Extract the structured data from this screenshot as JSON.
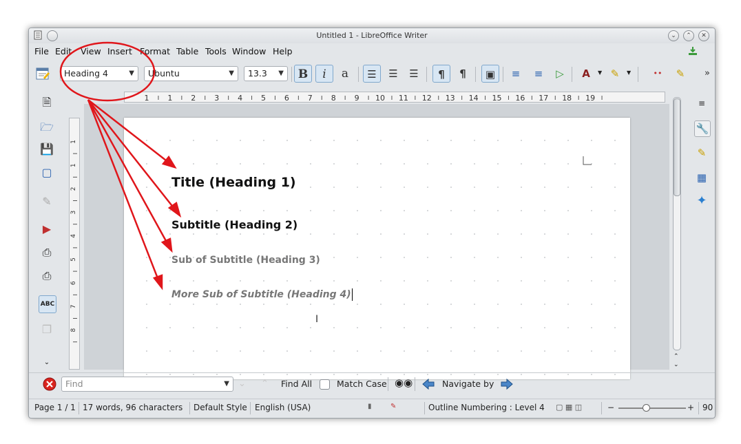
{
  "window": {
    "title": "Untitled 1 - LibreOffice Writer"
  },
  "menu": [
    "File",
    "Edit",
    "View",
    "Insert",
    "Format",
    "Table",
    "Tools",
    "Window",
    "Help"
  ],
  "toolbar": {
    "paragraph_style": "Heading 4",
    "font_name": "Ubuntu",
    "font_size": "13.3"
  },
  "ruler_numbers": [
    "1",
    "1",
    "2",
    "3",
    "4",
    "5",
    "6",
    "7",
    "8",
    "9",
    "10",
    "11",
    "12",
    "13",
    "14",
    "15",
    "16",
    "17",
    "18",
    "19"
  ],
  "vruler_numbers": [
    "1",
    "1",
    "2",
    "3",
    "4",
    "5",
    "6",
    "7",
    "8"
  ],
  "document": {
    "heading1": "Title (Heading 1)",
    "heading2": "Subtitle (Heading 2)",
    "heading3": "Sub of Subtitle (Heading 3)",
    "heading4": "More Sub of Subtitle (Heading 4)"
  },
  "findbar": {
    "placeholder": "Find",
    "find_all": "Find All",
    "match_case": "Match Case",
    "navigate_by": "Navigate by"
  },
  "status": {
    "page": "Page 1 / 1",
    "words": "17 words, 96 characters",
    "page_style": "Default Style",
    "language": "English (USA)",
    "outline": "Outline Numbering : Level 4",
    "zoom": "90"
  },
  "icons": {
    "spellcheck_label": "ABC"
  },
  "colors": {
    "annotation": "#e0161b",
    "heading_grey": "#777777",
    "toolbar_active": "#d8e6f3"
  }
}
